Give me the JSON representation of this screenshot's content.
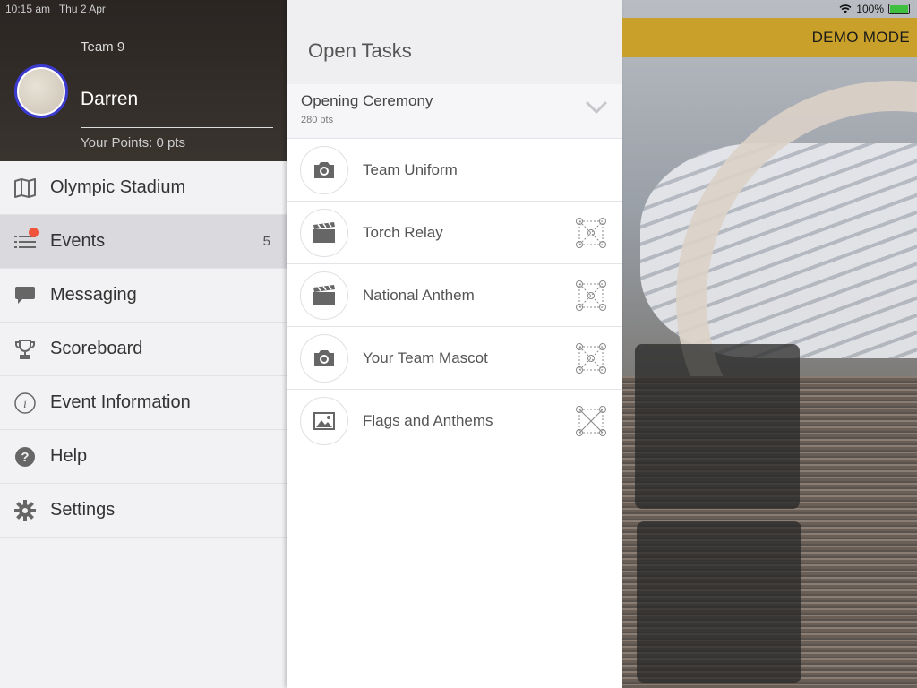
{
  "status_bar": {
    "time": "10:15 am",
    "date": "Thu 2 Apr",
    "battery": "100%"
  },
  "demo_mode": "DEMO MODE",
  "profile": {
    "team": "Team 9",
    "name": "Darren",
    "points": "Your Points: 0 pts"
  },
  "menu": [
    {
      "label": "Olympic Stadium",
      "icon": "map-icon"
    },
    {
      "label": "Events",
      "icon": "list-icon",
      "count": "5"
    },
    {
      "label": "Messaging",
      "icon": "chat-bubble-icon"
    },
    {
      "label": "Scoreboard",
      "icon": "trophy-icon"
    },
    {
      "label": "Event Information",
      "icon": "info-icon"
    },
    {
      "label": "Help",
      "icon": "question-icon"
    },
    {
      "label": "Settings",
      "icon": "gear-icon"
    }
  ],
  "open_tasks": {
    "title": "Open Tasks",
    "section": {
      "title": "Opening Ceremony",
      "points": "280 pts"
    },
    "tasks": [
      {
        "label": "Team Uniform",
        "icon": "camera-icon"
      },
      {
        "label": "Torch Relay",
        "icon": "clapperboard-icon"
      },
      {
        "label": "National Anthem",
        "icon": "clapperboard-icon"
      },
      {
        "label": "Your Team Mascot",
        "icon": "camera-icon"
      },
      {
        "label": "Flags and Anthems",
        "icon": "image-icon"
      }
    ]
  },
  "colors": {
    "accent": "#c8a02a",
    "notification": "#f0543a",
    "avatar_ring": "#3b3bd1"
  }
}
